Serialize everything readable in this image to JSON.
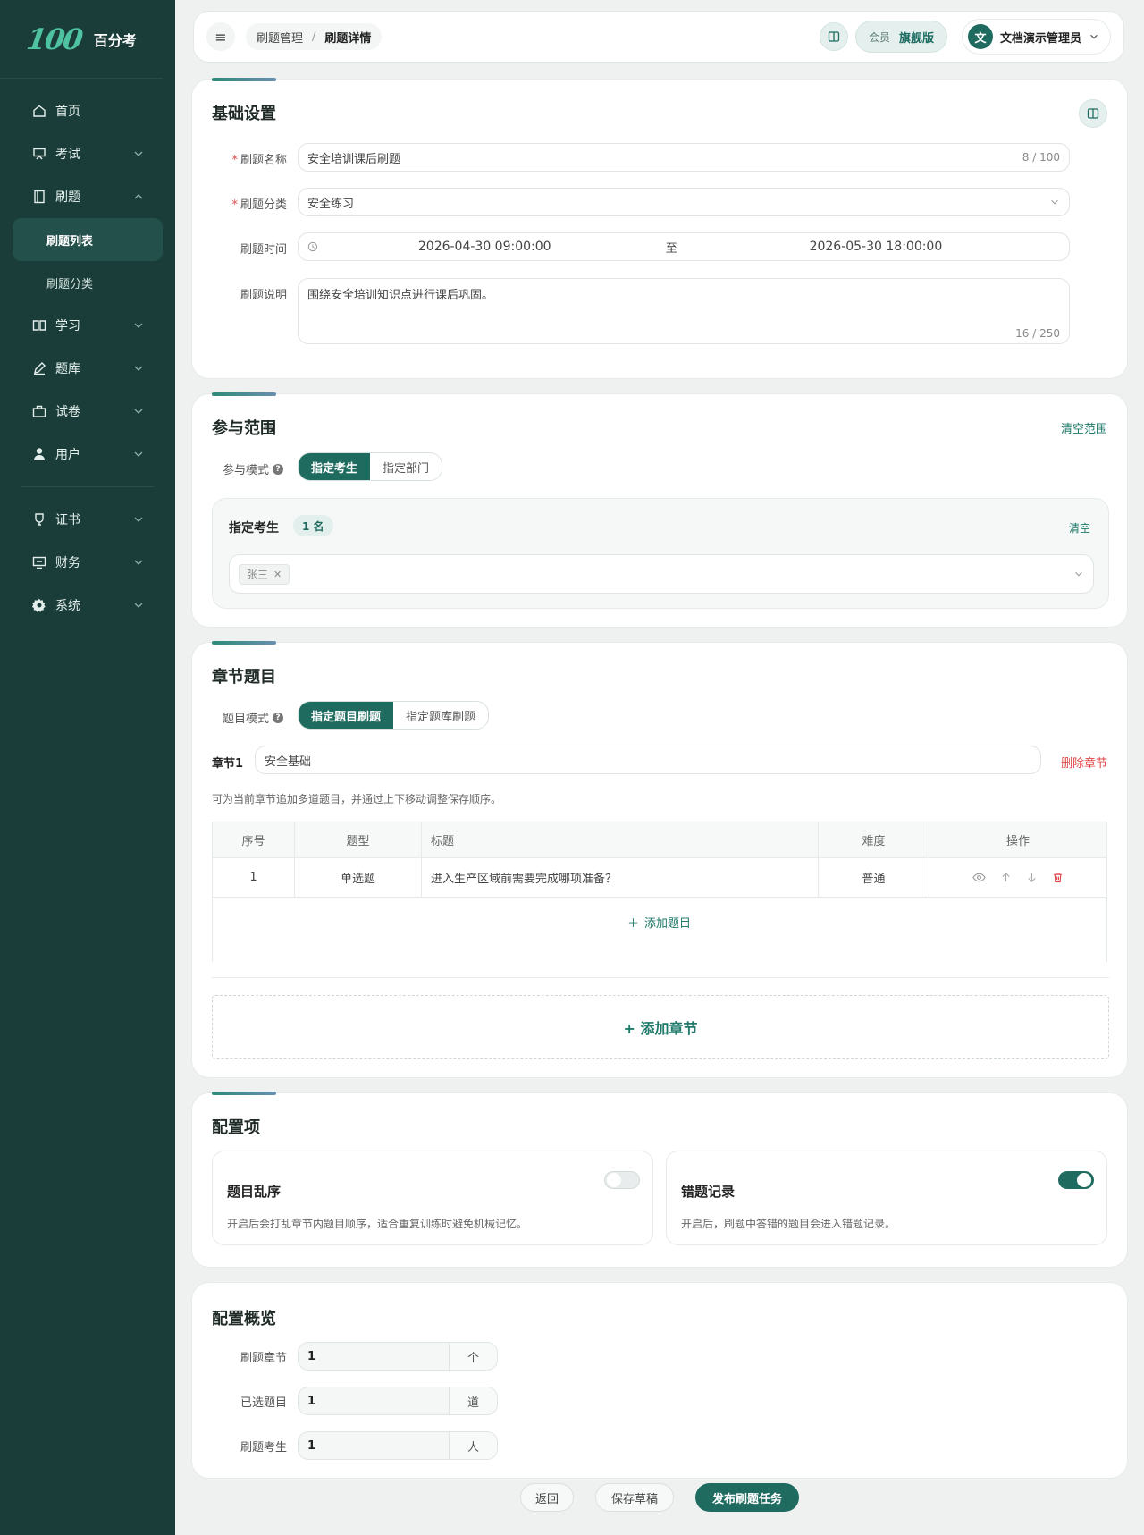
{
  "brand": {
    "logo": "100",
    "name": "百分考"
  },
  "sidebar": {
    "items": [
      {
        "label": "首页"
      },
      {
        "label": "考试"
      },
      {
        "label": "刷题"
      },
      {
        "label": "学习"
      },
      {
        "label": "题库"
      },
      {
        "label": "试卷"
      },
      {
        "label": "用户"
      },
      {
        "label": "证书"
      },
      {
        "label": "财务"
      },
      {
        "label": "系统"
      }
    ],
    "sub": [
      {
        "label": "刷题列表"
      },
      {
        "label": "刷题分类"
      }
    ]
  },
  "topbar": {
    "breadcrumb": [
      "刷题管理",
      "刷题详情"
    ],
    "breadcrumb_sep": "/",
    "vip_label": "会员",
    "vip_plan": "旗舰版",
    "avatar": "文",
    "user_name": "文档演示管理员"
  },
  "basic": {
    "title": "基础设置",
    "name_label": "刷题名称",
    "name_value": "安全培训课后刷题",
    "name_count": "8 / 100",
    "category_label": "刷题分类",
    "category_value": "安全练习",
    "time_label": "刷题时间",
    "time_start": "2026-04-30 09:00:00",
    "time_sep": "至",
    "time_end": "2026-05-30 18:00:00",
    "desc_label": "刷题说明",
    "desc_value": "围绕安全培训知识点进行课后巩固。",
    "desc_count": "16 / 250"
  },
  "scope": {
    "title": "参与范围",
    "clear_scope": "清空范围",
    "mode_label": "参与模式",
    "modes": [
      "指定考生",
      "指定部门"
    ],
    "box_title": "指定考生",
    "box_count": "1 名",
    "box_clear": "清空",
    "tags": [
      "张三"
    ]
  },
  "chapters": {
    "title": "章节题目",
    "mode_label": "题目模式",
    "modes": [
      "指定题目刷题",
      "指定题库刷题"
    ],
    "chapter_label": "章节1",
    "chapter_name": "安全基础",
    "delete_chapter": "删除章节",
    "hint": "可为当前章节追加多道题目，并通过上下移动调整保存顺序。",
    "columns": [
      "序号",
      "题型",
      "标题",
      "难度",
      "操作"
    ],
    "rows": [
      {
        "no": "1",
        "type": "单选题",
        "title": "进入生产区域前需要完成哪项准备？",
        "level": "普通"
      }
    ],
    "add_question": "添加题目",
    "add_chapter": "+ 添加章节"
  },
  "config": {
    "title": "配置项",
    "options": [
      {
        "title": "题目乱序",
        "desc": "开启后会打乱章节内题目顺序，适合重复训练时避免机械记忆。",
        "enabled": false
      },
      {
        "title": "错题记录",
        "desc": "开启后，刷题中答错的题目会进入错题记录。",
        "enabled": true
      }
    ]
  },
  "overview": {
    "title": "配置概览",
    "rows": [
      {
        "label": "刷题章节",
        "value": "1",
        "unit": "个"
      },
      {
        "label": "已选题目",
        "value": "1",
        "unit": "道"
      },
      {
        "label": "刷题考生",
        "value": "1",
        "unit": "人"
      }
    ]
  },
  "footer": {
    "back": "返回",
    "save_draft": "保存草稿",
    "publish": "发布刷题任务"
  },
  "colors": {
    "primary": "#1f6b60",
    "sidebar": "#1a3d3a",
    "danger": "#e04848"
  }
}
